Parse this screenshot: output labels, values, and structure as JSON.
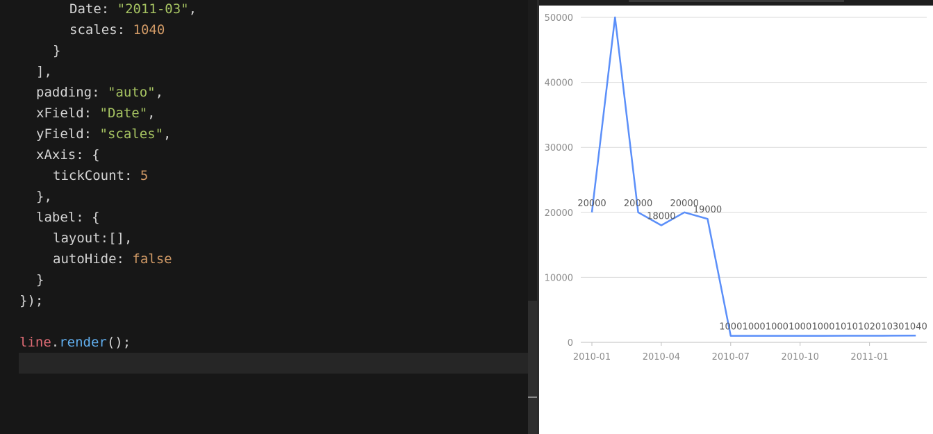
{
  "editor": {
    "lines": [
      [
        {
          "t": "Date",
          "c": "key"
        },
        {
          "t": ": ",
          "c": "punct"
        },
        {
          "t": "\"2011-03\"",
          "c": "str"
        },
        {
          "t": ",",
          "c": "punct"
        }
      ],
      [
        {
          "t": "scales",
          "c": "key"
        },
        {
          "t": ": ",
          "c": "punct"
        },
        {
          "t": "1040",
          "c": "num"
        }
      ],
      [
        {
          "t": "}",
          "c": "punct"
        }
      ],
      [
        {
          "t": "],",
          "c": "punct"
        }
      ],
      [
        {
          "t": "padding",
          "c": "key"
        },
        {
          "t": ": ",
          "c": "punct"
        },
        {
          "t": "\"auto\"",
          "c": "str"
        },
        {
          "t": ",",
          "c": "punct"
        }
      ],
      [
        {
          "t": "xField",
          "c": "key"
        },
        {
          "t": ": ",
          "c": "punct"
        },
        {
          "t": "\"Date\"",
          "c": "str"
        },
        {
          "t": ",",
          "c": "punct"
        }
      ],
      [
        {
          "t": "yField",
          "c": "key"
        },
        {
          "t": ": ",
          "c": "punct"
        },
        {
          "t": "\"scales\"",
          "c": "str"
        },
        {
          "t": ",",
          "c": "punct"
        }
      ],
      [
        {
          "t": "xAxis",
          "c": "key"
        },
        {
          "t": ": {",
          "c": "punct"
        }
      ],
      [
        {
          "t": "tickCount",
          "c": "key"
        },
        {
          "t": ": ",
          "c": "punct"
        },
        {
          "t": "5",
          "c": "num"
        }
      ],
      [
        {
          "t": "},",
          "c": "punct"
        }
      ],
      [
        {
          "t": "label",
          "c": "key"
        },
        {
          "t": ": {",
          "c": "punct"
        }
      ],
      [
        {
          "t": "layout",
          "c": "key"
        },
        {
          "t": ":[],",
          "c": "punct"
        }
      ],
      [
        {
          "t": "autoHide",
          "c": "key"
        },
        {
          "t": ": ",
          "c": "punct"
        },
        {
          "t": "false",
          "c": "bool"
        }
      ],
      [
        {
          "t": "}",
          "c": "punct"
        }
      ],
      [
        {
          "t": "});",
          "c": "punct"
        }
      ],
      [],
      [
        {
          "t": "line",
          "c": "var"
        },
        {
          "t": ".",
          "c": "punct"
        },
        {
          "t": "render",
          "c": "fn"
        },
        {
          "t": "();",
          "c": "punct"
        }
      ],
      []
    ]
  },
  "chart_data": {
    "type": "line",
    "x": [
      "2010-01",
      "2010-02",
      "2010-03",
      "2010-04",
      "2010-05",
      "2010-06",
      "2010-07",
      "2010-08",
      "2010-09",
      "2010-10",
      "2010-11",
      "2010-12",
      "2011-01",
      "2011-02",
      "2011-03"
    ],
    "values": [
      20000,
      50000,
      20000,
      18000,
      20000,
      19000,
      1000,
      1000,
      1000,
      1000,
      1000,
      1010,
      1020,
      1030,
      1040
    ],
    "labels": [
      "20000",
      "",
      "20000",
      "18000",
      "20000",
      "19000",
      "1000",
      "1000",
      "1000",
      "1000",
      "1000",
      "1010",
      "1020",
      "1030",
      "1040"
    ],
    "x_tick_labels": [
      "2010-01",
      "2010-04",
      "2010-07",
      "2010-10",
      "2011-01"
    ],
    "y_ticks": [
      0,
      10000,
      20000,
      30000,
      40000,
      50000
    ],
    "ylim": [
      0,
      50000
    ],
    "grid": "horizontal",
    "line_color": "#5b8ff9"
  }
}
